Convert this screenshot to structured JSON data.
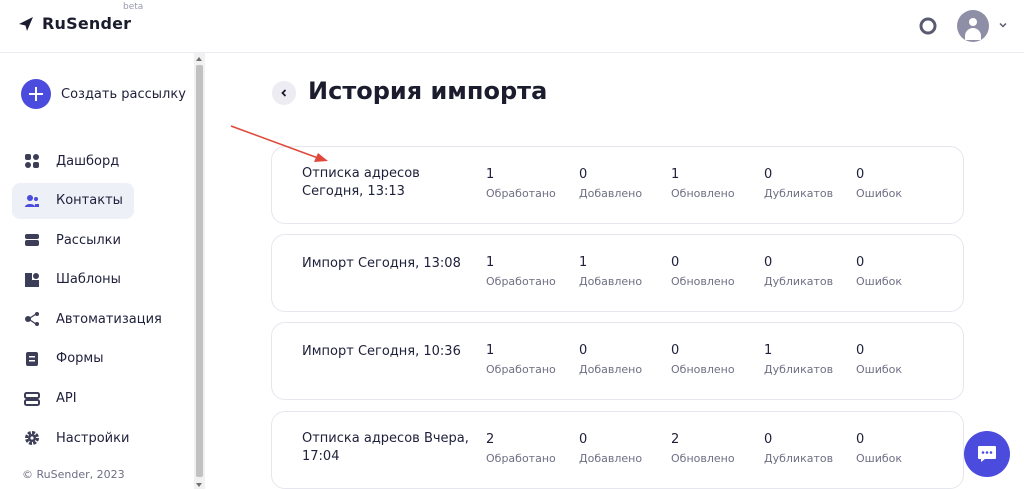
{
  "header": {
    "logo_text": "RuSender",
    "beta_label": "beta",
    "icons": {
      "logo": "paper-plane-icon",
      "help": "lifebuoy-icon",
      "avatar": "user-avatar",
      "menu": "chevron-down-icon"
    }
  },
  "sidebar": {
    "create_label": "Создать рассылку",
    "items": [
      {
        "label": "Дашборд",
        "icon": "dashboard-icon",
        "active": false
      },
      {
        "label": "Контакты",
        "icon": "contacts-icon",
        "active": true
      },
      {
        "label": "Рассылки",
        "icon": "mailings-icon",
        "active": false
      },
      {
        "label": "Шаблоны",
        "icon": "templates-icon",
        "active": false
      },
      {
        "label": "Автоматизация",
        "icon": "automation-icon",
        "active": false
      },
      {
        "label": "Формы",
        "icon": "forms-icon",
        "active": false
      },
      {
        "label": "API",
        "icon": "api-icon",
        "active": false
      },
      {
        "label": "Настройки",
        "icon": "settings-icon",
        "active": false
      }
    ],
    "copyright": "© RuSender, 2023"
  },
  "main": {
    "title": "История импорта",
    "imports": [
      {
        "title": "Отписка адресов\nСегодня, 13:13",
        "stats": [
          {
            "value": "1",
            "label": "Обработано"
          },
          {
            "value": "0",
            "label": "Добавлено"
          },
          {
            "value": "1",
            "label": "Обновлено"
          },
          {
            "value": "0",
            "label": "Дубликатов"
          },
          {
            "value": "0",
            "label": "Ошибок"
          }
        ]
      },
      {
        "title": "Импорт Сегодня, 13:08",
        "stats": [
          {
            "value": "1",
            "label": "Обработано"
          },
          {
            "value": "1",
            "label": "Добавлено"
          },
          {
            "value": "0",
            "label": "Обновлено"
          },
          {
            "value": "0",
            "label": "Дубликатов"
          },
          {
            "value": "0",
            "label": "Ошибок"
          }
        ]
      },
      {
        "title": "Импорт Сегодня, 10:36",
        "stats": [
          {
            "value": "1",
            "label": "Обработано"
          },
          {
            "value": "0",
            "label": "Добавлено"
          },
          {
            "value": "0",
            "label": "Обновлено"
          },
          {
            "value": "1",
            "label": "Дубликатов"
          },
          {
            "value": "0",
            "label": "Ошибок"
          }
        ]
      },
      {
        "title": "Отписка адресов Вчера,\n17:04",
        "stats": [
          {
            "value": "2",
            "label": "Обработано"
          },
          {
            "value": "0",
            "label": "Добавлено"
          },
          {
            "value": "2",
            "label": "Обновлено"
          },
          {
            "value": "0",
            "label": "Дубликатов"
          },
          {
            "value": "0",
            "label": "Ошибок"
          }
        ]
      }
    ]
  },
  "colors": {
    "accent": "#4b4bde",
    "annotation_arrow": "#e0483b"
  }
}
